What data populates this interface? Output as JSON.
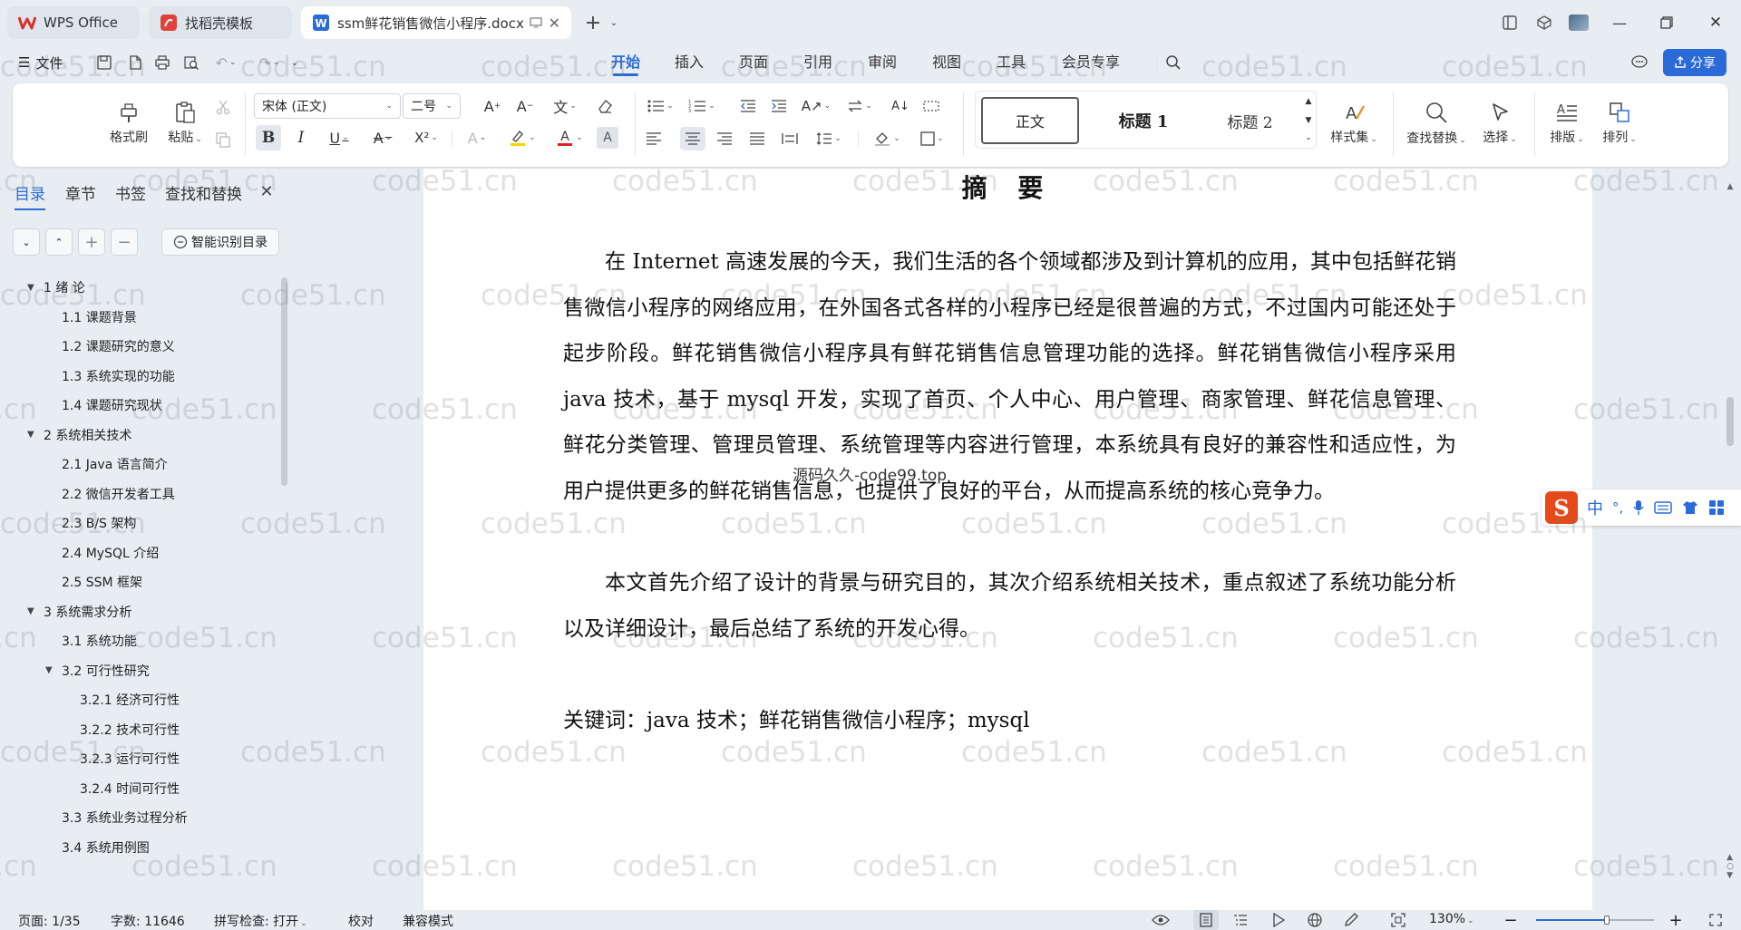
{
  "tabs": [
    {
      "label": "WPS Office"
    },
    {
      "label": "找稻壳模板"
    },
    {
      "label": "ssm鲜花销售微信小程序.docx"
    }
  ],
  "menu": {
    "file": "文件",
    "tabs": [
      "开始",
      "插入",
      "页面",
      "引用",
      "审阅",
      "视图",
      "工具",
      "会员专享"
    ],
    "share": "分享"
  },
  "ribbon": {
    "format_painter": "格式刷",
    "paste": "粘贴",
    "font_name": "宋体 (正文)",
    "font_size": "二号",
    "styles": [
      "正文",
      "标题 1",
      "标题 2"
    ],
    "style_set": "样式集",
    "find_replace": "查找替换",
    "select": "选择",
    "layout": "排版",
    "arrange": "排列"
  },
  "nav": {
    "tabs": [
      "目录",
      "章节",
      "书签",
      "查找和替换"
    ],
    "smart_toc": "智能识别目录",
    "toc": [
      {
        "label": "1 绪  论",
        "level": 1,
        "expanded": true
      },
      {
        "label": "1.1  课题背景",
        "level": 2
      },
      {
        "label": "1.2  课题研究的意义",
        "level": 2
      },
      {
        "label": "1.3  系统实现的功能",
        "level": 2
      },
      {
        "label": "1.4  课题研究现状",
        "level": 2
      },
      {
        "label": "2 系统相关技术",
        "level": 1,
        "expanded": true
      },
      {
        "label": "2.1 Java 语言简介",
        "level": 2
      },
      {
        "label": "2.2 微信开发者工具",
        "level": 2
      },
      {
        "label": "2.3 B/S 架构",
        "level": 2
      },
      {
        "label": "2.4 MySQL  介绍",
        "level": 2
      },
      {
        "label": "2.5 SSM 框架",
        "level": 2
      },
      {
        "label": "3 系统需求分析",
        "level": 1,
        "expanded": true
      },
      {
        "label": "3.1 系统功能",
        "level": 2
      },
      {
        "label": "3.2 可行性研究",
        "level": 2,
        "expanded": true
      },
      {
        "label": "3.2.1  经济可行性",
        "level": 3
      },
      {
        "label": "3.2.2  技术可行性",
        "level": 3
      },
      {
        "label": "3.2.3  运行可行性",
        "level": 3
      },
      {
        "label": "3.2.4  时间可行性",
        "level": 3
      },
      {
        "label": "3.3 系统业务过程分析",
        "level": 2
      },
      {
        "label": "3.4 系统用例图",
        "level": 2
      }
    ]
  },
  "document": {
    "title": "摘 要",
    "paragraphs": [
      "在 Internet 高速发展的今天，我们生活的各个领域都涉及到计算机的应用，其中包括鲜花销售微信小程序的网络应用，在外国各式各样的小程序已经是很普遍的方式，不过国内可能还处于起步阶段。鲜花销售微信小程序具有鲜花销售信息管理功能的选择。鲜花销售微信小程序采用 java 技术，基于 mysql 开发，实现了首页、个人中心、用户管理、商家管理、鲜花信息管理、鲜花分类管理、管理员管理、系统管理等内容进行管理，本系统具有良好的兼容性和适应性，为用户提供更多的鲜花销售信息，也提供了良好的平台，从而提高系统的核心竞争力。",
      "本文首先介绍了设计的背景与研究目的，其次介绍系统相关技术，重点叙述了系统功能分析以及详细设计，最后总结了系统的开发心得。"
    ],
    "keywords": "关键词：java 技术；鲜花销售微信小程序；mysql",
    "center_watermark": "源码久久-code99.top"
  },
  "watermark": "code51.cn",
  "ime": {
    "mode": "中",
    "punct": "°,"
  },
  "status": {
    "page": "页面: 1/35",
    "words": "字数: 11646",
    "spell": "拼写检查: 打开",
    "proof": "校对",
    "compat": "兼容模式",
    "zoom": "130%"
  },
  "colors": {
    "accent": "#2b6bd9",
    "wps_red": "#d7332b",
    "zoom_progress": 0.6
  }
}
